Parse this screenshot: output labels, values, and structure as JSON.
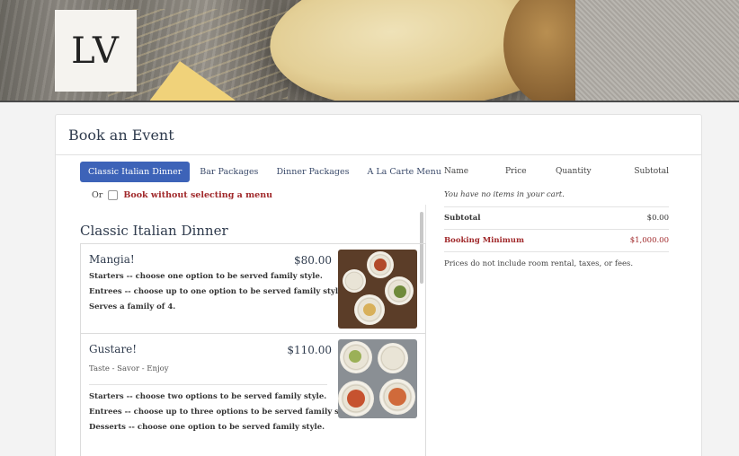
{
  "logo": {
    "text": "LV"
  },
  "card": {
    "title": "Book an Event"
  },
  "tabs": [
    {
      "label": "Classic Italian Dinner",
      "active": true
    },
    {
      "label": "Bar Packages",
      "active": false
    },
    {
      "label": "Dinner Packages",
      "active": false
    },
    {
      "label": "A La Carte Menu",
      "active": false
    }
  ],
  "book_option": {
    "or_label": "Or",
    "link_label": "Book without selecting a menu"
  },
  "menu": {
    "title": "Classic Italian Dinner",
    "packages": [
      {
        "name": "Mangia!",
        "price": "$80.00",
        "lines": [
          "Starters -- choose one option to be served family style.",
          "Entrees -- choose up to one option to be served family style.",
          "Serves a family of 4."
        ]
      },
      {
        "name": "Gustare!",
        "price": "$110.00",
        "tagline": "Taste - Savor - Enjoy",
        "lines": [
          "Starters -- choose two options to be served family style.",
          "Entrees -- choose up to three options to be served family style.",
          "Desserts -- choose one option to be served family style."
        ]
      }
    ]
  },
  "cart": {
    "headers": {
      "name": "Name",
      "price": "Price",
      "quantity": "Quantity",
      "subtotal": "Subtotal"
    },
    "empty_message": "You have no items in your cart.",
    "subtotal_label": "Subtotal",
    "subtotal_value": "$0.00",
    "minimum_label": "Booking Minimum",
    "minimum_value": "$1,000.00",
    "note": "Prices do not include room rental, taxes, or fees."
  },
  "colors": {
    "accent": "#3d63b8",
    "danger": "#a0282a",
    "text": "#2f3b4d"
  }
}
